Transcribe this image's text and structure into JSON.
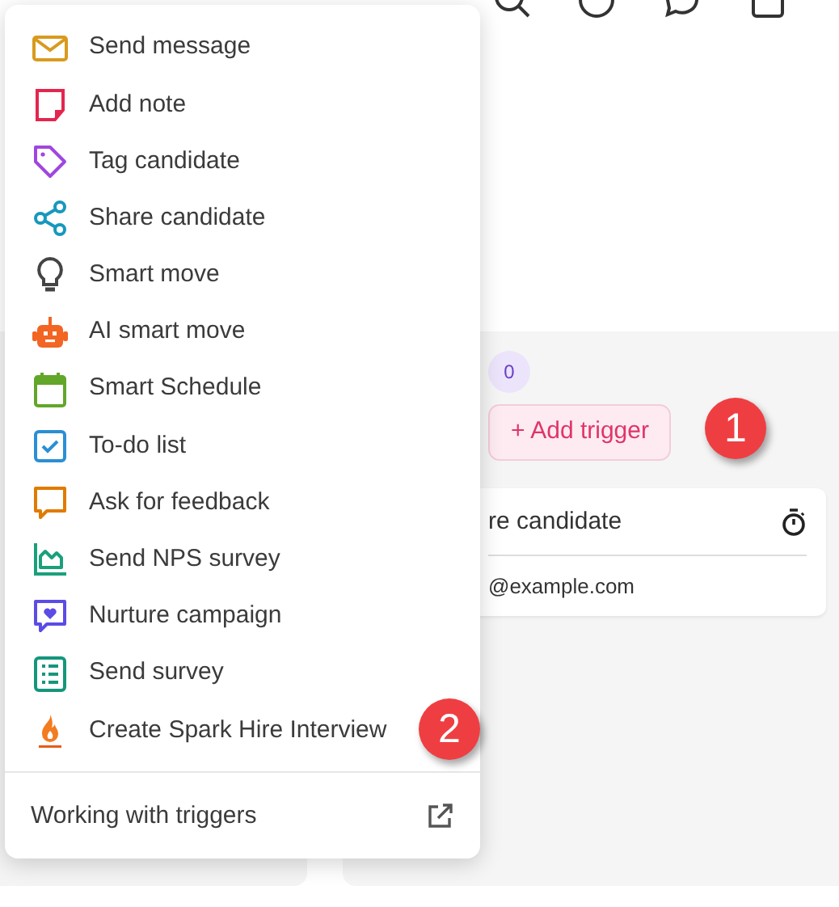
{
  "menu": {
    "items": [
      {
        "label": "Send message"
      },
      {
        "label": "Add note"
      },
      {
        "label": "Tag candidate"
      },
      {
        "label": "Share candidate"
      },
      {
        "label": "Smart move"
      },
      {
        "label": "AI smart move"
      },
      {
        "label": "Smart Schedule"
      },
      {
        "label": "To-do list"
      },
      {
        "label": "Ask for feedback"
      },
      {
        "label": "Send NPS survey"
      },
      {
        "label": "Nurture campaign"
      },
      {
        "label": "Send survey"
      },
      {
        "label": "Create Spark Hire Interview"
      }
    ],
    "footer": {
      "label": "Working with triggers"
    }
  },
  "column": {
    "count": "0",
    "add_trigger": "+ Add trigger",
    "card": {
      "title": "re candidate",
      "email": "@example.com"
    }
  },
  "callouts": [
    "1",
    "2"
  ]
}
